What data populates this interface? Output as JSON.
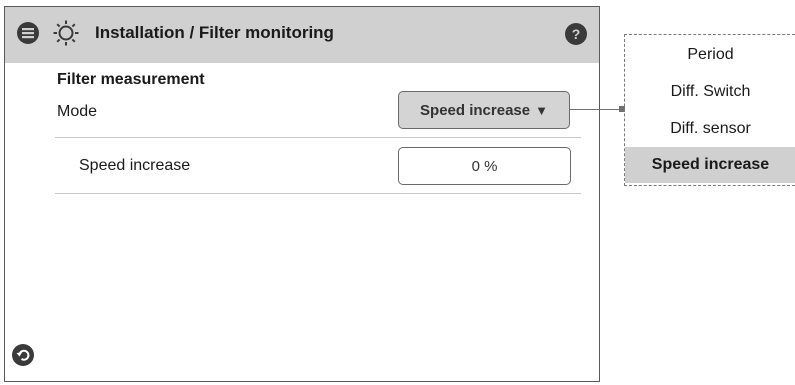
{
  "header": {
    "title": "Installation / Filter monitoring",
    "menu_icon": "menu-icon",
    "settings_icon": "gear-icon",
    "help_icon": "help-icon",
    "help_glyph": "?"
  },
  "section": {
    "title": "Filter measurement"
  },
  "mode": {
    "label": "Mode",
    "selected": "Speed increase",
    "arrow": "▼"
  },
  "speed_increase": {
    "label": "Speed increase",
    "value": "0 %"
  },
  "dropdown": {
    "options": [
      "Period",
      "Diff. Switch",
      "Diff. sensor",
      "Speed increase"
    ],
    "selected_index": 3
  },
  "footer": {
    "back_icon": "back-icon"
  },
  "colors": {
    "header_bg": "#d0d0d0",
    "selected_option_bg": "#d0d0d0",
    "icon_dark": "#3a3a3a"
  }
}
